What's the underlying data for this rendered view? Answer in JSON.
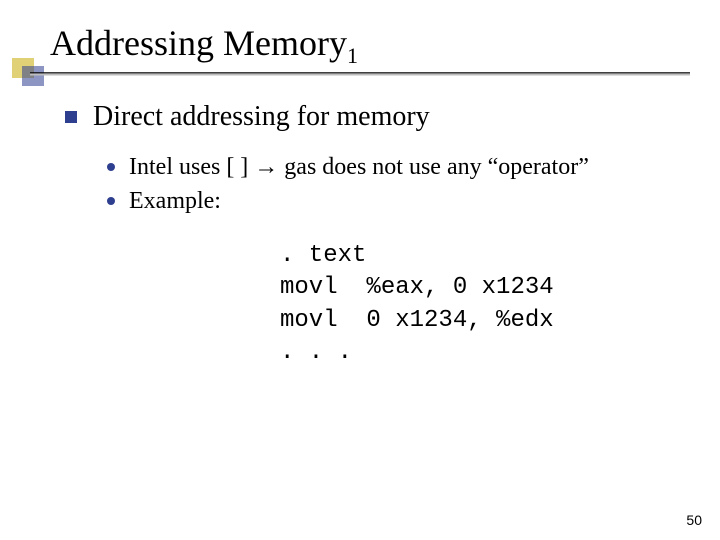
{
  "title": {
    "main": "Addressing Memory",
    "subscript": "1"
  },
  "content": {
    "heading": "Direct addressing for memory",
    "points": [
      {
        "pre": "Intel uses [ ] ",
        "post": " gas does not use any “operator”"
      },
      {
        "pre": "Example:",
        "post": ""
      }
    ]
  },
  "code": ". text\nmovl  %eax, 0 x1234\nmovl  0 x1234, %edx\n. . .",
  "page_number": "50",
  "colors": {
    "accent": "#2f3f8f",
    "line": "#bdbdbd"
  }
}
